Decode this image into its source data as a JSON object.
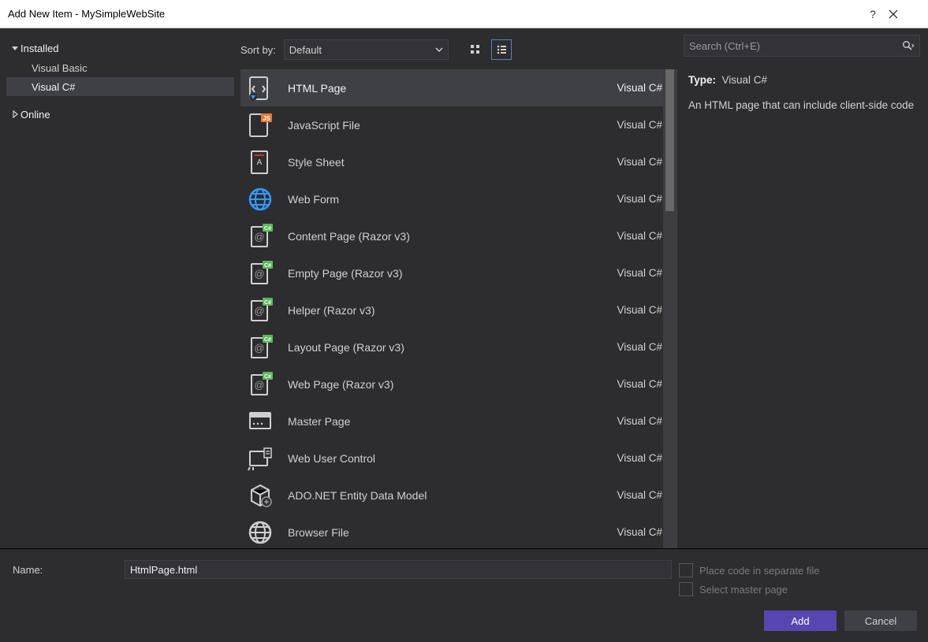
{
  "title": "Add New Item - MySimpleWebSite",
  "tree": {
    "installed_label": "Installed",
    "vb_label": "Visual Basic",
    "cs_label": "Visual C#",
    "online_label": "Online"
  },
  "sort": {
    "label": "Sort by:",
    "value": "Default"
  },
  "search": {
    "placeholder": "Search (Ctrl+E)"
  },
  "detail": {
    "type_label": "Type:",
    "type_value": "Visual C#",
    "description": "An HTML page that can include client-side code"
  },
  "name_label": "Name:",
  "name_value": "HtmlPage.html",
  "chk_separate": "Place code in separate file",
  "chk_master": "Select master page",
  "btn_add": "Add",
  "btn_cancel": "Cancel",
  "templates": [
    {
      "name": "HTML Page",
      "lang": "Visual C#",
      "icon": "html",
      "selected": true
    },
    {
      "name": "JavaScript File",
      "lang": "Visual C#",
      "icon": "js"
    },
    {
      "name": "Style Sheet",
      "lang": "Visual C#",
      "icon": "css"
    },
    {
      "name": "Web Form",
      "lang": "Visual C#",
      "icon": "globe"
    },
    {
      "name": "Content Page (Razor v3)",
      "lang": "Visual C#",
      "icon": "razor"
    },
    {
      "name": "Empty Page (Razor v3)",
      "lang": "Visual C#",
      "icon": "razor"
    },
    {
      "name": "Helper (Razor v3)",
      "lang": "Visual C#",
      "icon": "razor"
    },
    {
      "name": "Layout Page (Razor v3)",
      "lang": "Visual C#",
      "icon": "razor"
    },
    {
      "name": "Web Page (Razor v3)",
      "lang": "Visual C#",
      "icon": "razor"
    },
    {
      "name": "Master Page",
      "lang": "Visual C#",
      "icon": "master"
    },
    {
      "name": "Web User Control",
      "lang": "Visual C#",
      "icon": "control"
    },
    {
      "name": "ADO.NET Entity Data Model",
      "lang": "Visual C#",
      "icon": "entity"
    },
    {
      "name": "Browser File",
      "lang": "Visual C#",
      "icon": "browser"
    }
  ]
}
